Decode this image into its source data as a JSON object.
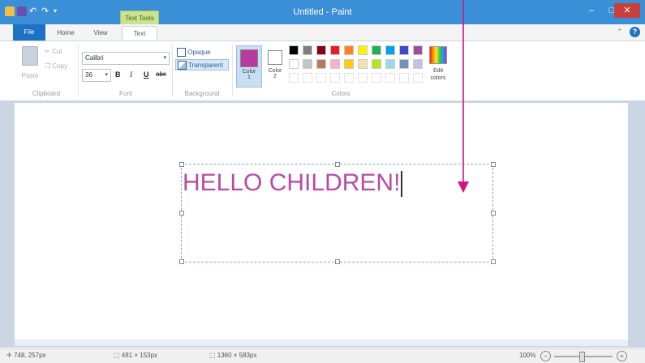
{
  "window": {
    "title": "Untitled - Paint",
    "contextual_tab": "Text Tools"
  },
  "tabs": [
    "File",
    "Home",
    "View",
    "Text"
  ],
  "clipboard": {
    "paste": "Paste",
    "cut": "Cut",
    "copy": "Copy",
    "label": "Clipboard"
  },
  "font": {
    "family": "Calibri",
    "size": "36",
    "bold": "B",
    "italic": "I",
    "underline": "U",
    "strike": "abc",
    "label": "Font"
  },
  "background": {
    "opaque": "Opaque",
    "transparent": "Transparent",
    "label": "Background"
  },
  "colors": {
    "color1_label": "Color",
    "color1_num": "1",
    "color2_label": "Color",
    "color2_num": "2",
    "edit_label": "Edit colors",
    "label": "Colors",
    "color1": "#b83a9e",
    "color2": "#ffffff",
    "row1": [
      "#000000",
      "#7f7f7f",
      "#880015",
      "#ed1c24",
      "#ff7f27",
      "#fff200",
      "#22b14c",
      "#00a2e8",
      "#3f48cc",
      "#a349a4"
    ],
    "row2": [
      "#ffffff",
      "#c3c3c3",
      "#b97a57",
      "#ffaec9",
      "#ffc90e",
      "#efe4b0",
      "#b5e61d",
      "#99d9ea",
      "#7092be",
      "#c8bfe7"
    ]
  },
  "canvas": {
    "text": "HELLO CHILDREN!",
    "text_color": "#b84aa6"
  },
  "status": {
    "cursor_pos": "748, 257px",
    "selection_size": "481 × 153px",
    "image_size": "1360 × 583px",
    "zoom": "100%"
  },
  "annotation": {
    "arrow_color": "#d4137f"
  }
}
